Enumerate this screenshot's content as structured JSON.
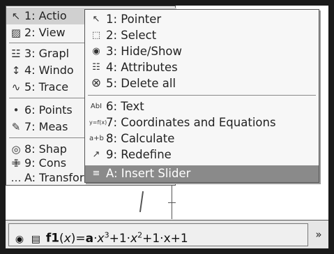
{
  "main_menu": {
    "items": [
      {
        "label": "1: Actio",
        "icon": "pointer-arrow-icon",
        "glyph": "↖"
      },
      {
        "label": "2: View",
        "icon": "view-icon",
        "glyph": "▨"
      },
      {
        "label": "3: Grapl",
        "icon": "graph-icon",
        "glyph": "☳"
      },
      {
        "label": "4: Windo",
        "icon": "window-icon",
        "glyph": "↕"
      },
      {
        "label": "5: Trace",
        "icon": "trace-icon",
        "glyph": "∿"
      },
      {
        "label": "6: Points",
        "icon": "point-icon",
        "glyph": "•"
      },
      {
        "label": "7: Meas",
        "icon": "measure-icon",
        "glyph": "✎"
      },
      {
        "label": "8: Shap",
        "icon": "shape-icon",
        "glyph": "◎"
      },
      {
        "label": "9: Cons",
        "icon": "construction-icon",
        "glyph": "✙"
      },
      {
        "label": "A: Transformation",
        "icon": "transformation-icon",
        "glyph": "…"
      }
    ]
  },
  "sub_menu": {
    "items": [
      {
        "label": "1: Pointer",
        "icon": "pointer-icon",
        "glyph": "↖"
      },
      {
        "label": "2: Select",
        "icon": "select-icon",
        "glyph": "⬚"
      },
      {
        "label": "3: Hide/Show",
        "icon": "eye-icon",
        "glyph": "◉"
      },
      {
        "label": "4: Attributes",
        "icon": "attributes-icon",
        "glyph": "☷"
      },
      {
        "label": "5: Delete all",
        "icon": "delete-icon",
        "glyph": "⊗"
      },
      {
        "label": "6: Text",
        "icon": "text-icon",
        "glyph": "AbI"
      },
      {
        "label": "7: Coordinates and Equations",
        "icon": "coordinates-icon",
        "glyph": "y=f(x)"
      },
      {
        "label": "8: Calculate",
        "icon": "calculate-icon",
        "glyph": "a+b"
      },
      {
        "label": "9: Redefine",
        "icon": "redefine-icon",
        "glyph": "↗"
      },
      {
        "label": "A: Insert Slider",
        "icon": "slider-icon",
        "glyph": "≡"
      }
    ],
    "selected_index": 9
  },
  "entry_line": {
    "name": "f1",
    "var": "x",
    "expr_a": "a",
    "expr_pow3": "3",
    "expr_pow2": "2",
    "expr_rest1": "+1·",
    "expr_rest2": "+1·x+1",
    "expand_glyph": "»"
  }
}
